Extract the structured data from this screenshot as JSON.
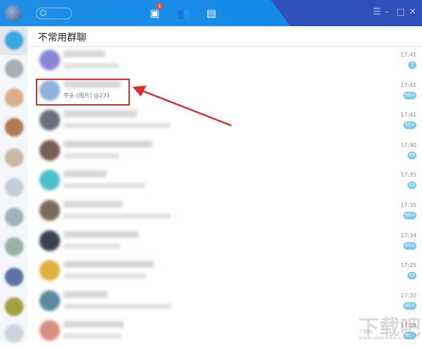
{
  "titlebar": {
    "notification_count": "1",
    "icons": [
      "messages-icon",
      "contacts-icon",
      "files-icon"
    ],
    "controls": [
      "menu-icon",
      "minimize-icon",
      "maximize-icon",
      "close-icon"
    ]
  },
  "header": {
    "title": "不常用群聊"
  },
  "conversations": [
    {
      "time": "17:41",
      "count": "7",
      "preview": ""
    },
    {
      "time": "17:41",
      "count": "99+",
      "preview": "芋头:[图片] @233"
    },
    {
      "time": "17:41",
      "count": "99+",
      "preview": ""
    },
    {
      "time": "17:40",
      "count": "55",
      "preview": ""
    },
    {
      "time": "17:35",
      "count": "10",
      "preview": ""
    },
    {
      "time": "17:35",
      "count": "99+",
      "preview": ""
    },
    {
      "time": "17:34",
      "count": "99+",
      "preview": ""
    },
    {
      "time": "17:25",
      "count": "42",
      "preview": ""
    },
    {
      "time": "17:20",
      "count": "99+",
      "preview": ""
    },
    {
      "time": "17:09",
      "count": "99+",
      "preview": ""
    }
  ],
  "colors": {
    "accent": "#168be8",
    "badge": "#7ccbee",
    "highlight": "#e02a2a"
  },
  "watermark": "下载吧 www.xiazaiba.com"
}
